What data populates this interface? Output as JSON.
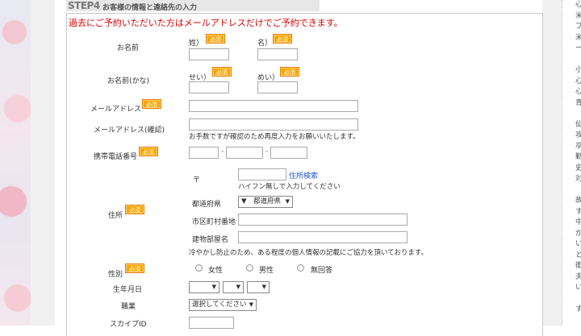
{
  "step": {
    "number": "STEP4",
    "title": "お客様の情報と連絡先の入力"
  },
  "notice": "過去にご予約いただいた方はメールアドレスだけでご予約できます。",
  "required_badge": "必須",
  "fields": {
    "name": {
      "label": "お名前",
      "last": "姓）",
      "first": "名）"
    },
    "name_kana": {
      "label": "お名前(かな)",
      "last": "せい）",
      "first": "めい）"
    },
    "email": {
      "label": "メールアドレス"
    },
    "email_confirm": {
      "label": "メールアドレス(確認)",
      "note": "お手数ですが確認のため再度入力をお願いいたします。"
    },
    "phone": {
      "label": "携帯電話番号",
      "sep": "-"
    },
    "address": {
      "label": "住所",
      "postal_mark": "〒",
      "postal_search": "住所検索",
      "postal_note": "ハイフン無しで入力してください",
      "prefecture_label": "都道府県",
      "prefecture_value": "▼　都道府県",
      "city_label": "市区町村番地",
      "building_label": "建物部屋名",
      "privacy_note": "冷やかし防止のため、ある程度の個人情報の記載にご協力を頂いております。"
    },
    "gender": {
      "label": "性別",
      "options": [
        "女性",
        "男性",
        "無回答"
      ]
    },
    "birthday": {
      "label": "生年月日"
    },
    "occupation": {
      "label": "職業",
      "value": "選択してください"
    },
    "skype": {
      "label": "スカイプID"
    }
  },
  "sidebar_chars": [
    "心",
    "米",
    "プ",
    "米",
    "ー",
    "",
    "小",
    "心",
    "心",
    "青",
    "",
    "仙",
    "攻",
    "卒",
    "勤",
    "史",
    "対",
    "",
    "故",
    "す",
    "中",
    "が",
    "い",
    "と",
    "衛",
    "夫",
    "い",
    "",
    "す"
  ]
}
